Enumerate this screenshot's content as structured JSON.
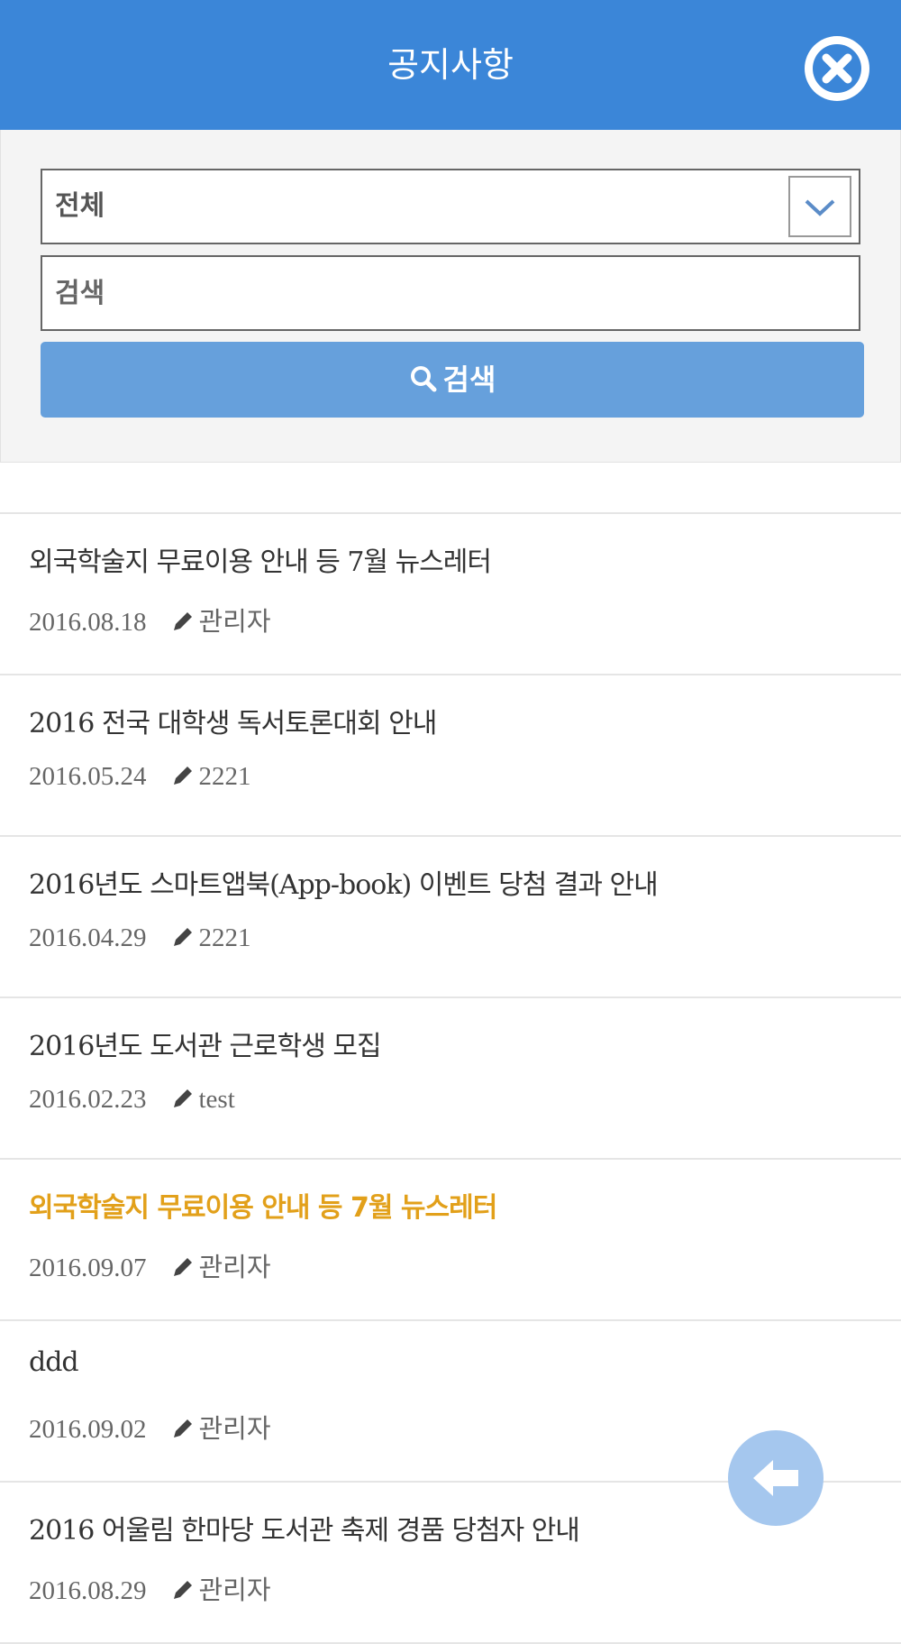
{
  "header": {
    "title": "공지사항",
    "accent_color": "#3b86d8",
    "close_icon": "close-circle-icon"
  },
  "search": {
    "category_selected": "전체",
    "keyword_placeholder": "검색",
    "button_label": "검색",
    "button_color": "#66a0dc"
  },
  "notices": [
    {
      "title": "외국학술지 무료이용 안내 등 7월 뉴스레터",
      "date": "2016.08.18",
      "author": "관리자",
      "highlight": false
    },
    {
      "title": "2016 전국 대학생 독서토론대회 안내",
      "date": "2016.05.24",
      "author": "2221",
      "highlight": false
    },
    {
      "title": "2016년도 스마트앱북(App-book) 이벤트 당첨 결과 안내",
      "date": "2016.04.29",
      "author": "2221",
      "highlight": false
    },
    {
      "title": "2016년도 도서관 근로학생 모집",
      "date": "2016.02.23",
      "author": "test",
      "highlight": false
    },
    {
      "title": "외국학술지 무료이용 안내 등 7월 뉴스레터",
      "date": "2016.09.07",
      "author": "관리자",
      "highlight": true
    },
    {
      "title": "ddd",
      "date": "2016.09.02",
      "author": "관리자",
      "highlight": false
    },
    {
      "title": "2016 어울림 한마당 도서관 축제 경품 당첨자 안내",
      "date": "2016.08.29",
      "author": "관리자",
      "highlight": false
    }
  ],
  "highlight_color": "#e2a01a",
  "back_button_icon": "arrow-left-icon"
}
